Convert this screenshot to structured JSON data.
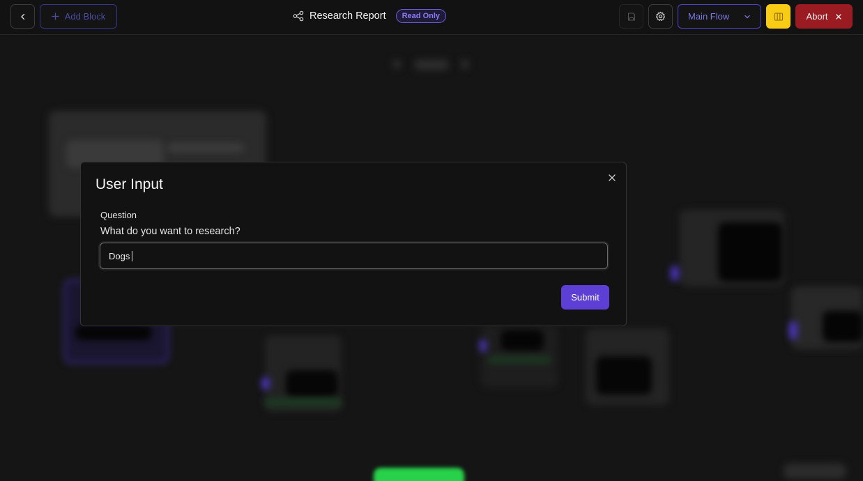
{
  "topbar": {
    "add_block_label": "Add Block",
    "title": "Research Report",
    "badge": "Read Only",
    "flow_select_value": "Main Flow",
    "abort_label": "Abort"
  },
  "icons": {
    "back": "chevron-left-icon",
    "add": "plus-icon",
    "workflow": "workflow-icon",
    "save": "save-icon",
    "settings": "gear-icon",
    "dropdown": "chevron-down-icon",
    "columns": "columns-icon",
    "close": "close-icon"
  },
  "colors": {
    "accent": "#5d3fd6",
    "badge": "#8a7cf0",
    "yellow": "#f8cc14",
    "abort": "#9a1b22",
    "green": "#27d14a"
  },
  "modal": {
    "title": "User Input",
    "question_label": "Question",
    "question_text": "What do you want to research?",
    "input_value": "Dogs",
    "submit_label": "Submit"
  }
}
